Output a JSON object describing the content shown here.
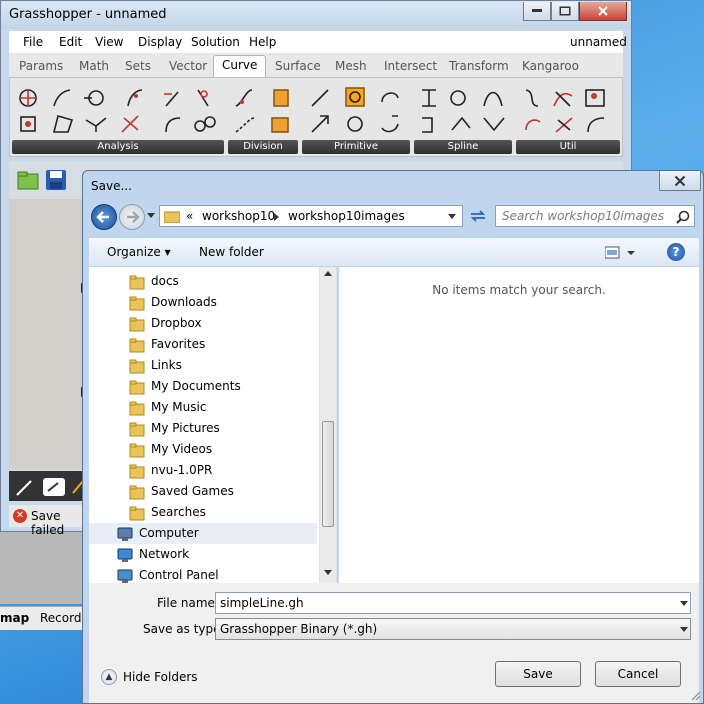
{
  "grasshopper": {
    "title": "Grasshopper - unnamed",
    "menu": [
      "File",
      "Edit",
      "View",
      "Display",
      "Solution",
      "Help"
    ],
    "doc_name": "unnamed",
    "tabs": [
      "Params",
      "Math",
      "Sets",
      "Vector",
      "Curve",
      "Surface",
      "Mesh",
      "Intersect",
      "Transform",
      "Kangaroo"
    ],
    "active_tab": "Curve",
    "groups": [
      "Analysis",
      "Division",
      "Primitive",
      "Spline",
      "Util"
    ],
    "status": "Save failed"
  },
  "rhino": {
    "tabs": [
      "map",
      "Record"
    ]
  },
  "dialog": {
    "title": "Save...",
    "breadcrumb": {
      "overflow": "«",
      "parts": [
        "workshop10",
        "workshop10images"
      ]
    },
    "search_placeholder": "Search workshop10images",
    "organize": "Organize",
    "new_folder": "New folder",
    "help_icon": "?",
    "tree": [
      {
        "label": "docs",
        "icon": "folder-icon"
      },
      {
        "label": "Downloads",
        "icon": "downloads-folder-icon"
      },
      {
        "label": "Dropbox",
        "icon": "folder-icon"
      },
      {
        "label": "Favorites",
        "icon": "favorites-folder-icon"
      },
      {
        "label": "Links",
        "icon": "links-folder-icon"
      },
      {
        "label": "My Documents",
        "icon": "documents-folder-icon"
      },
      {
        "label": "My Music",
        "icon": "music-folder-icon"
      },
      {
        "label": "My Pictures",
        "icon": "pictures-folder-icon"
      },
      {
        "label": "My Videos",
        "icon": "videos-folder-icon"
      },
      {
        "label": "nvu-1.0PR",
        "icon": "folder-icon"
      },
      {
        "label": "Saved Games",
        "icon": "games-folder-icon"
      },
      {
        "label": "Searches",
        "icon": "searches-folder-icon"
      },
      {
        "label": "Computer",
        "icon": "computer-icon"
      },
      {
        "label": "Network",
        "icon": "network-icon"
      },
      {
        "label": "Control Panel",
        "icon": "control-panel-icon"
      }
    ],
    "empty_message": "No items match your search.",
    "file_name_label": "File name:",
    "file_name_value": "simpleLine.gh",
    "save_type_label": "Save as type:",
    "save_type_value": "Grasshopper Binary (*.gh)",
    "hide_folders": "Hide Folders",
    "save": "Save",
    "cancel": "Cancel"
  },
  "colors": {
    "folder": "#e8c45a",
    "accent": "#2a63b5",
    "error": "#d43a2a"
  }
}
